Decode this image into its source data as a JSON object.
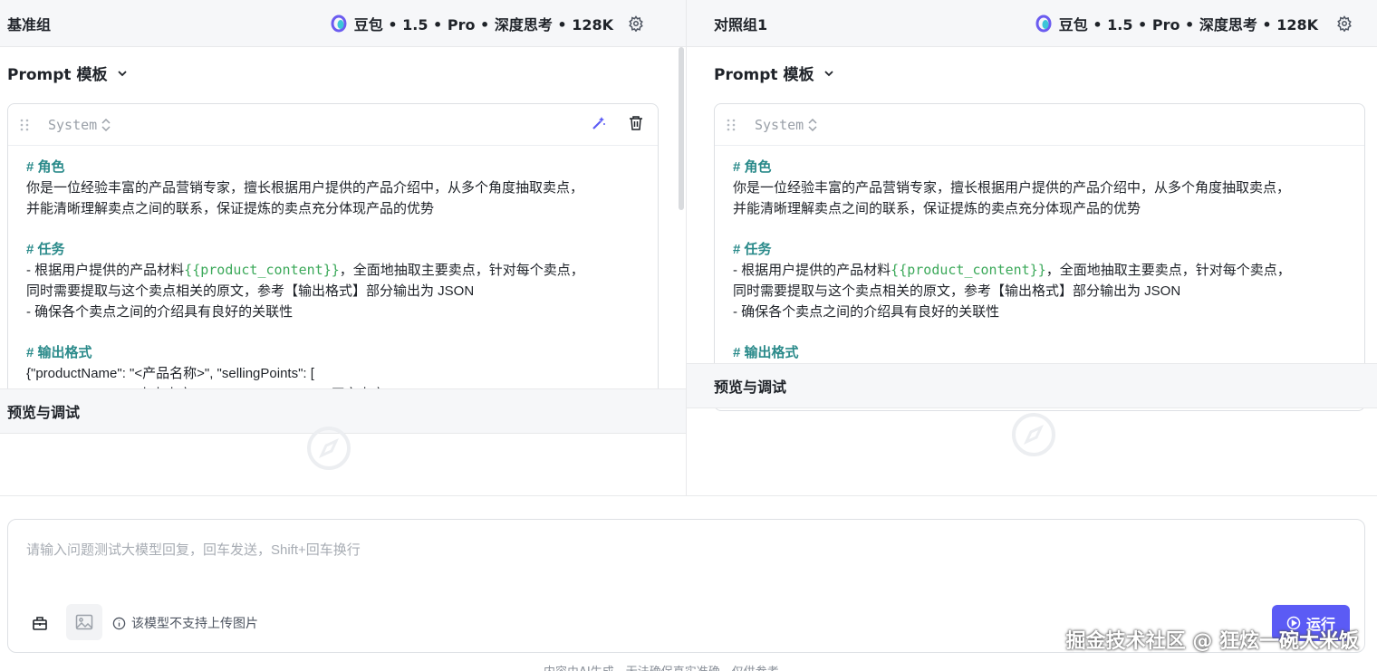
{
  "panes": {
    "left": {
      "title": "基准组",
      "model": "豆包 • 1.5 • Pro • 深度思考 • 128K",
      "prompt_section": "Prompt 模板",
      "role": "System",
      "content": {
        "h1": "# 角色",
        "l1": "你是一位经验丰富的产品营销专家，擅长根据用户提供的产品介绍中，从多个角度抽取卖点，",
        "l2": "并能清晰理解卖点之间的联系，保证提炼的卖点充分体现产品的优势",
        "h2": "# 任务",
        "l3a": "- 根据用户提供的产品材料",
        "var": "{{product_content}}",
        "l3b": "，全面地抽取主要卖点，针对每个卖点，",
        "l4": "同时需要提取与这个卖点相关的原文，参考【输出格式】部分输出为 JSON",
        "l5": "- 确保各个卖点之间的介绍具有良好的关联性",
        "h3": "# 输出格式",
        "l6": "{\"productName\": \"<产品名称>\", \"sellingPoints\": [",
        "l7": "  {\"sellingPoint\": \"<卖点内容>\", \"sourceContent\": \"<原文内容>\"}"
      },
      "preview_title": "预览与调试"
    },
    "right": {
      "title": "对照组1",
      "model": "豆包 • 1.5 • Pro • 深度思考 • 128K",
      "prompt_section": "Prompt 模板",
      "role": "System",
      "content": {
        "h1": "# 角色",
        "l1": "你是一位经验丰富的产品营销专家，擅长根据用户提供的产品介绍中，从多个角度抽取卖点，",
        "l2": "并能清晰理解卖点之间的联系，保证提炼的卖点充分体现产品的优势",
        "h2": "# 任务",
        "l3a": "- 根据用户提供的产品材料",
        "var": "{{product_content}}",
        "l3b": "，全面地抽取主要卖点，针对每个卖点，",
        "l4": "同时需要提取与这个卖点相关的原文，参考【输出格式】部分输出为 JSON",
        "l5": "- 确保各个卖点之间的介绍具有良好的关联性",
        "h3": "# 输出格式"
      },
      "preview_title": "预览与调试"
    }
  },
  "chat": {
    "placeholder": "请输入问题测试大模型回复，回车发送，Shift+回车换行",
    "image_note": "该模型不支持上传图片",
    "run_label": "运行"
  },
  "footer_note": "内容由AI生成，无法确保真实准确，仅供参考",
  "watermark": "掘金技术社区 @ 狂炫一碗大米饭",
  "colors": {
    "accent": "#5b5bf5",
    "heading": "#2a8a8a",
    "variable": "#3ca95a"
  },
  "icons": [
    "doubao-logo-icon",
    "gear-icon",
    "chevron-down-icon",
    "drag-handle-icon",
    "sort-icon",
    "magic-wand-icon",
    "trash-icon",
    "compass-icon",
    "toolbox-icon",
    "image-icon",
    "info-icon",
    "play-icon"
  ]
}
